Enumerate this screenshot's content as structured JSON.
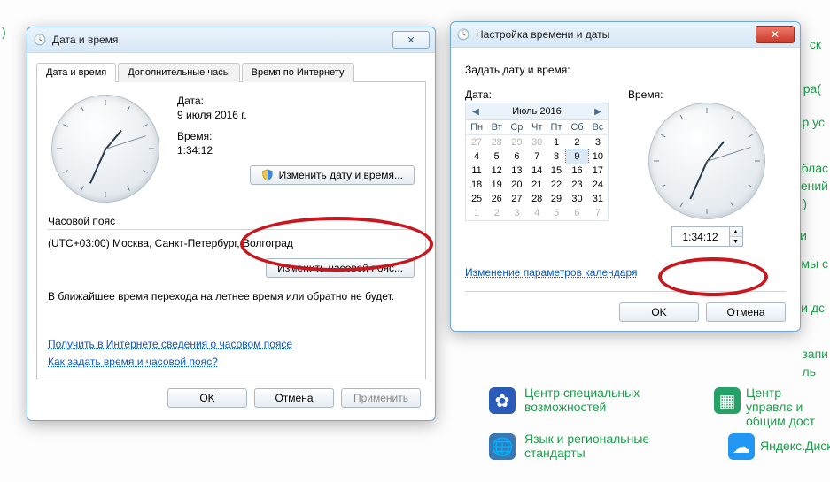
{
  "bgLinks": {
    "a": "ск",
    "b": "ра(",
    "c": "р ус",
    "d": "блас",
    "e": "ений",
    "f": ")",
    "g": "и",
    "h": "мы с",
    "i": "и дс",
    "j": "запи",
    "k": "ль",
    "cp1": "Центр специальных возможностей",
    "cp2": "Центр управлє и общим дост",
    "cp3": "Язык и региональные стандарты",
    "cp4": "Яндекс.Диск"
  },
  "win1": {
    "title": "Дата и время",
    "tabs": [
      "Дата и время",
      "Дополнительные часы",
      "Время по Интернету"
    ],
    "dateLabel": "Дата:",
    "dateValue": "9 июля 2016 г.",
    "timeLabel": "Время:",
    "timeValue": "1:34:12",
    "changeBtn": "Изменить дату и время...",
    "tzHeader": "Часовой пояс",
    "tzValue": "(UTC+03:00) Москва, Санкт-Петербург, Волгоград",
    "tzBtn": "Изменить часовой пояс...",
    "dstNote": "В ближайшее время перехода на летнее время или обратно не будет.",
    "link1": "Получить в Интернете сведения о часовом поясе",
    "link2": "Как задать время и часовой пояс?",
    "ok": "OK",
    "cancel": "Отмена",
    "apply": "Применить"
  },
  "win2": {
    "title": "Настройка времени и даты",
    "heading": "Задать дату и время:",
    "dateLabel": "Дата:",
    "timeLabel": "Время:",
    "monthYear": "Июль 2016",
    "dow": [
      "Пн",
      "Вт",
      "Ср",
      "Чт",
      "Пт",
      "Сб",
      "Вс"
    ],
    "weeks": [
      [
        {
          "d": "27",
          "o": 1
        },
        {
          "d": "28",
          "o": 1
        },
        {
          "d": "29",
          "o": 1
        },
        {
          "d": "30",
          "o": 1
        },
        {
          "d": "1"
        },
        {
          "d": "2"
        },
        {
          "d": "3"
        }
      ],
      [
        {
          "d": "4"
        },
        {
          "d": "5"
        },
        {
          "d": "6"
        },
        {
          "d": "7"
        },
        {
          "d": "8"
        },
        {
          "d": "9",
          "s": 1
        },
        {
          "d": "10"
        }
      ],
      [
        {
          "d": "11"
        },
        {
          "d": "12"
        },
        {
          "d": "13"
        },
        {
          "d": "14"
        },
        {
          "d": "15"
        },
        {
          "d": "16"
        },
        {
          "d": "17"
        }
      ],
      [
        {
          "d": "18"
        },
        {
          "d": "19"
        },
        {
          "d": "20"
        },
        {
          "d": "21"
        },
        {
          "d": "22"
        },
        {
          "d": "23"
        },
        {
          "d": "24"
        }
      ],
      [
        {
          "d": "25"
        },
        {
          "d": "26"
        },
        {
          "d": "27"
        },
        {
          "d": "28"
        },
        {
          "d": "29"
        },
        {
          "d": "30"
        },
        {
          "d": "31"
        }
      ],
      [
        {
          "d": "1",
          "o": 1
        },
        {
          "d": "2",
          "o": 1
        },
        {
          "d": "3",
          "o": 1
        },
        {
          "d": "4",
          "o": 1
        },
        {
          "d": "5",
          "o": 1
        },
        {
          "d": "6",
          "o": 1
        },
        {
          "d": "7",
          "o": 1
        }
      ]
    ],
    "timeValue": "1:34:12",
    "calLink": "Изменение параметров календаря",
    "ok": "OK",
    "cancel": "Отмена"
  }
}
